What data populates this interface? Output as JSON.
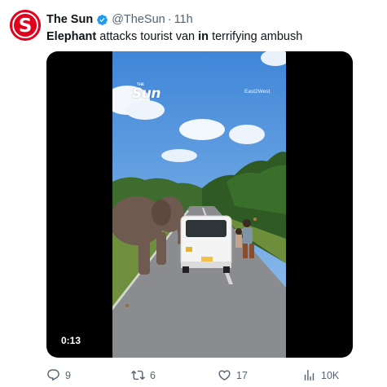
{
  "tweet": {
    "author": {
      "display_name": "The Sun",
      "handle": "@TheSun",
      "verified": true,
      "avatar_icon": "the-sun-logo-icon",
      "brand_color": "#e3001b"
    },
    "separator": "·",
    "timestamp": "11h",
    "text": {
      "w1": "Elephant",
      "w2": " attacks tourist van ",
      "w3": "in",
      "w4": " terrifying ambush"
    },
    "media": {
      "type": "video",
      "duration": "0:13",
      "watermark_logo": "Sun",
      "watermark_logo_small": "THE",
      "watermark_source": "East2West"
    },
    "actions": {
      "replies": "9",
      "retweets": "6",
      "likes": "17",
      "views": "10K"
    }
  },
  "colors": {
    "text_primary": "#0f1419",
    "text_secondary": "#536471",
    "verified_blue": "#1d9bf0"
  }
}
